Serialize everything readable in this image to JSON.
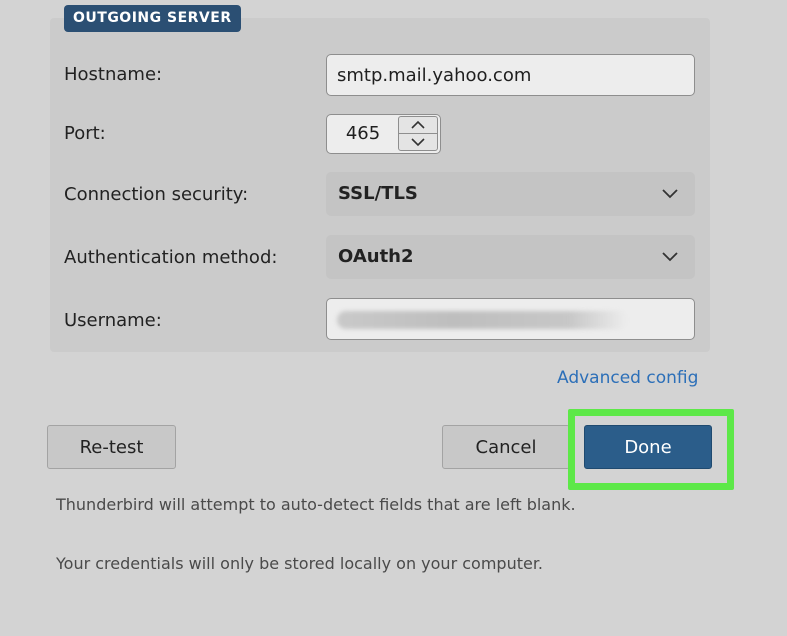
{
  "outgoing_server": {
    "section_label": "OUTGOING SERVER",
    "hostname": {
      "label": "Hostname:",
      "value": "smtp.mail.yahoo.com"
    },
    "port": {
      "label": "Port:",
      "value": "465"
    },
    "connection_security": {
      "label": "Connection security:",
      "selected": "SSL/TLS"
    },
    "authentication_method": {
      "label": "Authentication method:",
      "selected": "OAuth2"
    },
    "username": {
      "label": "Username:",
      "value": ""
    }
  },
  "advanced_config_link": "Advanced config",
  "buttons": {
    "retest": "Re-test",
    "cancel": "Cancel",
    "done": "Done"
  },
  "info": {
    "auto_detect": "Thunderbird will attempt to auto-detect fields that are left blank.",
    "credentials": "Your credentials will only be stored locally on your computer."
  },
  "colors": {
    "accent": "#2b5d8a",
    "badge": "#2b4f73",
    "link": "#2c6fb8",
    "highlight": "#5de848",
    "background": "#d3d3d3"
  },
  "icons": {
    "select_chevron": "chevron-down-icon",
    "stepper_up": "chevron-up-icon",
    "stepper_down": "chevron-down-icon"
  }
}
